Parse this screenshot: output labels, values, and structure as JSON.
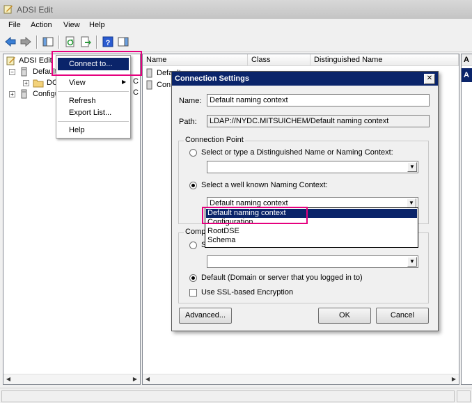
{
  "window": {
    "title": "ADSI Edit"
  },
  "menubar": [
    "File",
    "Action",
    "View",
    "Help"
  ],
  "tree": {
    "root_label": "ADSI Edit",
    "default_label": "Default",
    "dc_label": "DC",
    "config_label": "Configur",
    "cut_char": "C"
  },
  "list": {
    "columns": [
      "Name",
      "Class",
      "Distinguished Name"
    ],
    "rows": [
      "Default",
      "Con"
    ]
  },
  "right_pane": {
    "header": "A",
    "selected": "A"
  },
  "context_menu": {
    "items": [
      "Connect to...",
      "View",
      "Refresh",
      "Export List...",
      "Help"
    ]
  },
  "dialog": {
    "title": "Connection Settings",
    "close_glyph": "✕",
    "name_label": "Name:",
    "name_value": "Default naming context",
    "path_label": "Path:",
    "path_value": "LDAP://NYDC.MITSUICHEM/Default naming context",
    "connection_point_title": "Connection Point",
    "radio_dn_label": "Select or type a Distinguished Name or Naming Context:",
    "radio_wellknown_label": "Select a well known Naming Context:",
    "wellknown_value": "Default naming context",
    "dropdown_options": [
      "Default naming context",
      "Configuration",
      "RootDSE",
      "Schema"
    ],
    "computer_group_title": "Comp",
    "radio_computer_label": "S",
    "radio_default_label": "Default (Domain or server that you logged in to)",
    "ssl_label": "Use SSL-based Encryption",
    "advanced_button": "Advanced...",
    "ok_button": "OK",
    "cancel_button": "Cancel"
  },
  "colors": {
    "highlight": "#e5007e",
    "selection": "#0a246a",
    "titlebar": "#0a246a"
  }
}
